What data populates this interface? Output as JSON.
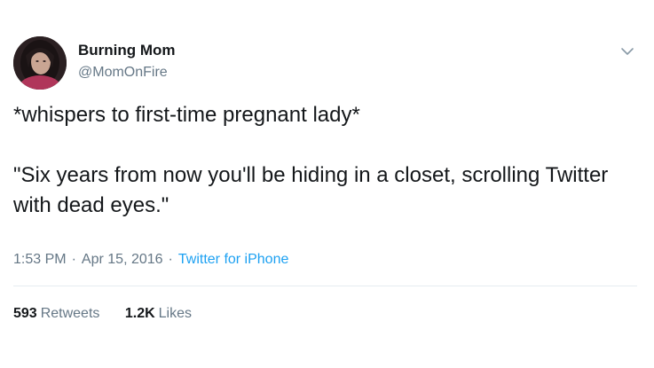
{
  "tweet": {
    "author": {
      "name": "Burning Mom",
      "handle": "@MomOnFire",
      "avatar_icon": "profile-photo"
    },
    "menu_icon": "chevron-down-icon",
    "text_line1": "*whispers to first-time pregnant lady*",
    "text_line2": "\"Six years from now you'll be hiding in a closet, scrolling Twitter with dead eyes.\"",
    "time": "1:53 PM",
    "separator": "·",
    "date": "Apr 15, 2016",
    "source": "Twitter for iPhone",
    "retweets_count": "593",
    "retweets_label": "Retweets",
    "likes_count": "1.2K",
    "likes_label": "Likes"
  },
  "colors": {
    "text": "#14171a",
    "secondary": "#657786",
    "link": "#1da1f2",
    "divider": "#e6ecf0"
  }
}
